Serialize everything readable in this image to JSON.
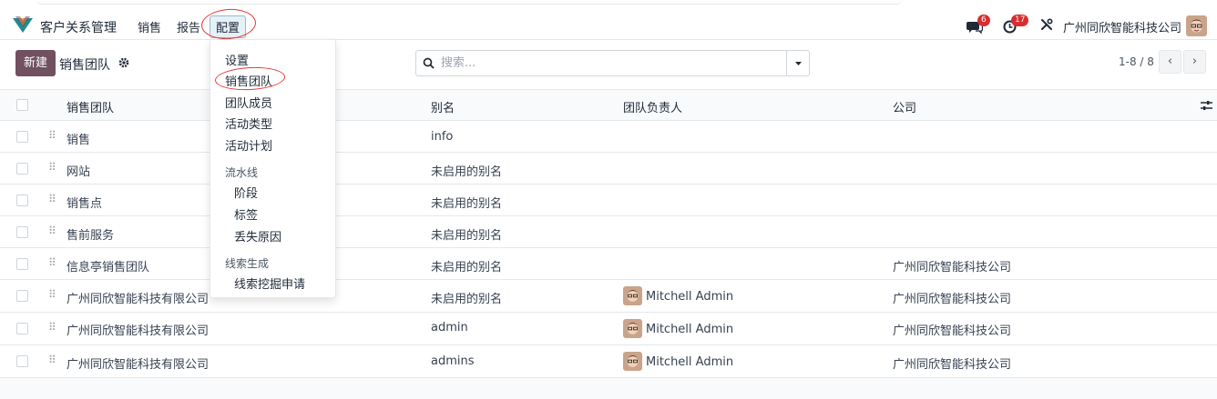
{
  "topbar": {
    "app_name": "客户关系管理",
    "menu_sales": "销售",
    "menu_report": "报告",
    "menu_config": "配置",
    "messages_badge": "6",
    "activities_badge": "17",
    "company": "广州同欣智能科技公司"
  },
  "control": {
    "new_label": "新建",
    "title": "销售团队",
    "search_placeholder": "搜索...",
    "pager": "1-8 / 8",
    "prev": "‹",
    "next": "›"
  },
  "table": {
    "headers": [
      "销售团队",
      "别名",
      "团队负责人",
      "公司"
    ],
    "rows": [
      {
        "name": "销售",
        "alias": "info",
        "leader": "",
        "company": ""
      },
      {
        "name": "网站",
        "alias": "未启用的别名",
        "leader": "",
        "company": ""
      },
      {
        "name": "销售点",
        "alias": "未启用的别名",
        "leader": "",
        "company": ""
      },
      {
        "name": "售前服务",
        "alias": "未启用的别名",
        "leader": "",
        "company": ""
      },
      {
        "name": "信息亭销售团队",
        "alias": "未启用的别名",
        "leader": "",
        "company": "广州同欣智能科技公司"
      },
      {
        "name": "广州同欣智能科技有限公司",
        "alias": "未启用的别名",
        "leader": "Mitchell Admin",
        "company": "广州同欣智能科技公司"
      },
      {
        "name": "广州同欣智能科技有限公司",
        "alias": "admin",
        "leader": "Mitchell Admin",
        "company": "广州同欣智能科技公司"
      },
      {
        "name": "广州同欣智能科技有限公司",
        "alias": "admins",
        "leader": "Mitchell Admin",
        "company": "广州同欣智能科技公司"
      }
    ]
  },
  "dropdown": {
    "items": [
      "设置",
      "销售团队",
      "团队成员",
      "活动类型",
      "活动计划"
    ],
    "pipeline_header": "流水线",
    "pipeline_items": [
      "阶段",
      "标签",
      "丢失原因"
    ],
    "lead_header": "线索生成",
    "lead_items": [
      "线索挖掘申请"
    ]
  },
  "colors": {
    "brand": "#71505f",
    "badge": "#d92d2d",
    "annotation": "#e53935"
  }
}
